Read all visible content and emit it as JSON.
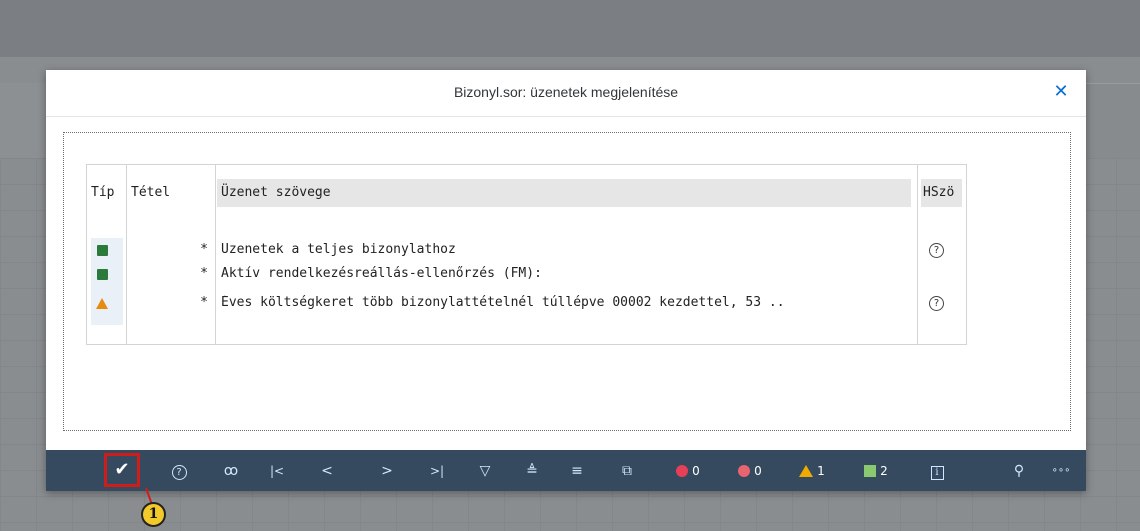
{
  "dialog": {
    "title": "Bizonyl.sor: üzenetek megjelenítése",
    "close_icon": "close-icon"
  },
  "table": {
    "headers": {
      "tip": "Típ",
      "tetel": "Tétel",
      "uzenet": "Üzenet szövege",
      "hszo": "HSzö"
    },
    "rows": [
      {
        "type": "success",
        "tetel": "*",
        "text": "Üzenetek a teljes bizonylathoz",
        "help": "?"
      },
      {
        "type": "success",
        "tetel": "*",
        "text": "Aktív rendelkezésreállás-ellenőrzés (FM):",
        "help": ""
      },
      {
        "type": "warning",
        "tetel": "*",
        "text": "Éves költségkeret több bizonylattételnél túllépve 00002 kezdettel, 53 ..",
        "help": "?"
      }
    ]
  },
  "toolbar": {
    "ok": "✔",
    "help": "?",
    "find": "ꝏ",
    "first": "|<",
    "prev": "<",
    "next": ">",
    "last": ">|",
    "filter": "▽",
    "sort_asc": "≜",
    "sort_desc": "≡",
    "copy": "⧉",
    "stop_count": "0",
    "error_count": "0",
    "warning_count": "1",
    "success_count": "2",
    "info": "i",
    "search": "⚲",
    "more": "∘∘∘"
  },
  "callout": {
    "number": "1"
  },
  "colors": {
    "toolbar_bg": "#354a5f",
    "accent": "#0a6ed1",
    "highlight": "#d11c1c",
    "success": "#2b7a3b",
    "warning": "#e88a10"
  }
}
